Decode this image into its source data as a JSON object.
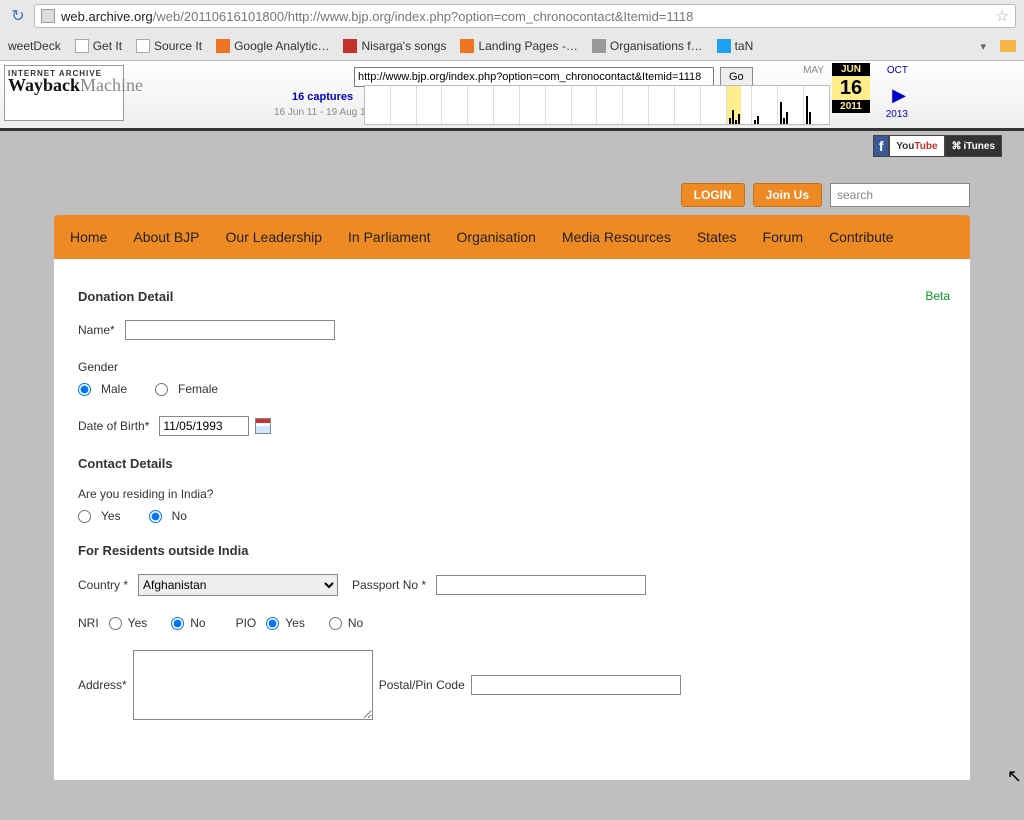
{
  "browser": {
    "url_prefix": "web.archive.org",
    "url_rest": "/web/20110616101800/http://www.bjp.org/index.php?option=com_chronocontact&Itemid=1118",
    "bookmarks": [
      "weetDeck",
      "Get It",
      "Source It",
      "Google Analytic…",
      "Nisarga's songs",
      "Landing Pages -…",
      "Organisations f…",
      "taN"
    ]
  },
  "wayback": {
    "logo_line1": "INTERNET ARCHIVE",
    "logo_line2a": "Wayback",
    "logo_line2b": "Machine",
    "url_value": "http://www.bjp.org/index.php?option=com_chronocontact&Itemid=1118",
    "go": "Go",
    "captures": "16 captures",
    "range": "16 Jun 11 - 19 Aug 14",
    "month_prev": "MAY",
    "month_cur": "JUN",
    "day": "16",
    "year_cur": "2011",
    "month_next": "OCT",
    "year_next": "2013"
  },
  "header": {
    "login": "LOGIN",
    "join": "Join Us",
    "search_placeholder": "search",
    "nav": [
      "Home",
      "About BJP",
      "Our Leadership",
      "In Parliament",
      "Organisation",
      "Media Resources",
      "States",
      "Forum",
      "Contribute"
    ],
    "beta": "Beta",
    "social": {
      "fb": "f",
      "yt1": "You",
      "yt2": "Tube",
      "it": "iTunes"
    }
  },
  "form": {
    "section1": "Donation Detail",
    "name_label": "Name*",
    "gender_label": "Gender",
    "male": "Male",
    "female": "Female",
    "dob_label": "Date of Birth*",
    "dob_value": "11/05/1993",
    "section2": "Contact Details",
    "residing_label": "Are you residing in India?",
    "yes": "Yes",
    "no": "No",
    "section3": "For Residents outside India",
    "country_label": "Country *",
    "country_value": "Afghanistan",
    "passport_label": "Passport No *",
    "nri_label": "NRI",
    "pio_label": "PIO",
    "address_label": "Address*",
    "postal_label": "Postal/Pin Code"
  }
}
